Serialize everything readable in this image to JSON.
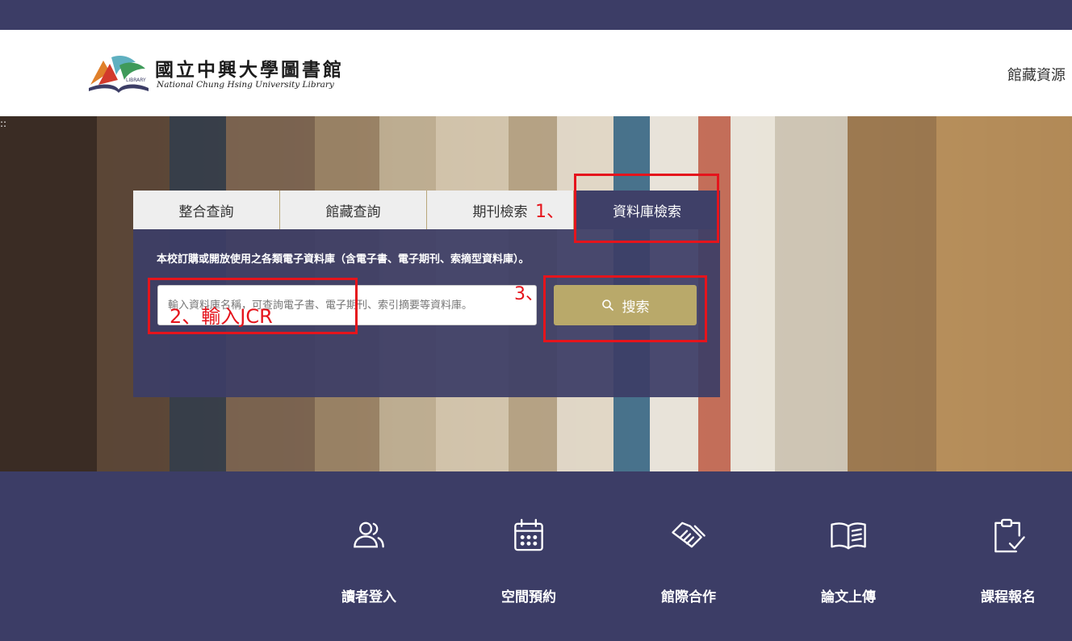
{
  "header": {
    "logo_zh": "國立中興大學圖書館",
    "logo_en": "National Chung Hsing University Library",
    "logo_badge": "LIBRARY",
    "nav_collection": "館藏資源"
  },
  "search": {
    "tabs": [
      {
        "label": "整合查詢"
      },
      {
        "label": "館藏查詢"
      },
      {
        "label": "期刊檢索"
      },
      {
        "label": "資料庫檢索"
      }
    ],
    "description": "本校訂購或開放使用之各類電子資料庫（含電子書、電子期刊、索摘型資料庫）。",
    "placeholder": "輸入資料庫名稱，可查詢電子書、電子期刊、索引摘要等資料庫。",
    "button_label": "搜索"
  },
  "annotations": {
    "step1": "1、",
    "step2": "2、輸入JCR",
    "step3": "3、",
    "color": "#e5141c"
  },
  "quick_links": [
    {
      "label": "讀者登入",
      "icon": "users-icon"
    },
    {
      "label": "空間預約",
      "icon": "calendar-icon"
    },
    {
      "label": "館際合作",
      "icon": "handshake-icon"
    },
    {
      "label": "論文上傳",
      "icon": "open-book-icon"
    },
    {
      "label": "課程報名",
      "icon": "clipboard-check-icon"
    }
  ],
  "colors": {
    "navy": "#3c3d66",
    "gold": "#b9a96a"
  }
}
